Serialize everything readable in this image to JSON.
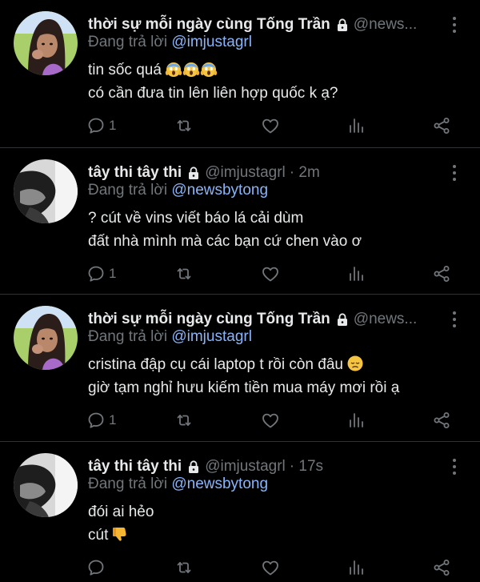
{
  "tweets": [
    {
      "display_name": "thời sự mỗi ngày cùng Tống Trần",
      "handle": "@news...",
      "time": "",
      "reply_prefix": "Đang trả lời ",
      "reply_to": "@imjustagrl",
      "lines": [
        "tin sốc quá",
        "có cần đưa tin lên liên hợp quốc k ạ?"
      ],
      "line_emojis": [
        [
          "face-screaming-in-fear",
          "face-screaming-in-fear",
          "face-screaming-in-fear"
        ],
        []
      ],
      "reply_count": "1",
      "avatar": "cartoon-girl"
    },
    {
      "display_name": "tây thi tây thi",
      "handle": "@imjustagrl",
      "time": "· 2m",
      "reply_prefix": "Đang trả lời ",
      "reply_to": "@newsbytong",
      "lines": [
        "? cút về vins viết báo lá cải dùm",
        "đất nhà mình mà các bạn cứ chen vào ơ"
      ],
      "line_emojis": [
        [],
        []
      ],
      "reply_count": "1",
      "avatar": "bw-photo"
    },
    {
      "display_name": "thời sự mỗi ngày cùng Tống Trần",
      "handle": "@news...",
      "time": "",
      "reply_prefix": "Đang trả lời ",
      "reply_to": "@imjustagrl",
      "lines": [
        "cristina đập cụ cái laptop t rồi còn đâu",
        "giờ tạm nghỉ hưu kiếm tiền mua máy mơi rồi ạ"
      ],
      "line_emojis": [
        [
          "disappointed-face"
        ],
        []
      ],
      "reply_count": "1",
      "avatar": "cartoon-girl"
    },
    {
      "display_name": "tây thi tây thi",
      "handle": "@imjustagrl",
      "time": "· 17s",
      "reply_prefix": "Đang trả lời ",
      "reply_to": "@newsbytong",
      "lines": [
        "đói ai hẻo",
        "cút"
      ],
      "line_emojis": [
        [],
        [
          "thumbs-down"
        ]
      ],
      "reply_count": "",
      "avatar": "bw-photo"
    }
  ],
  "icons": {
    "lock": "lock-icon",
    "more": "more-vertical-icon",
    "reply": "reply-bubble-icon",
    "retweet": "retweet-icon",
    "like": "heart-icon",
    "views": "analytics-bars-icon",
    "share": "share-icon"
  },
  "colors": {
    "background": "#000000",
    "text": "#e7e9ea",
    "muted": "#71767b",
    "mention": "#8ab4f8",
    "divider": "#2f3336"
  }
}
